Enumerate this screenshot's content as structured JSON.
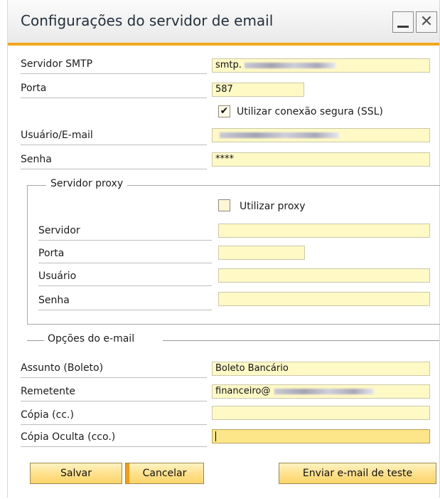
{
  "window": {
    "title": "Configurações do servidor de email",
    "minimize_glyph": "_",
    "close_glyph": "✕"
  },
  "smtp": {
    "server_label": "Servidor SMTP",
    "server_value": "smtp.",
    "port_label": "Porta",
    "port_value": "587",
    "ssl_label": "Utilizar conexão segura (SSL)",
    "ssl_checked": true,
    "ssl_mark": "✔",
    "user_label": "Usuário/E-mail",
    "user_value": "",
    "password_label": "Senha",
    "password_value": "****"
  },
  "proxy": {
    "group_title": "Servidor proxy",
    "use_label": "Utilizar proxy",
    "use_checked": false,
    "server_label": "Servidor",
    "server_value": "",
    "port_label": "Porta",
    "port_value": "",
    "user_label": "Usuário",
    "user_value": "",
    "password_label": "Senha",
    "password_value": ""
  },
  "email_options": {
    "group_title": "Opções do e-mail",
    "subject_label": "Assunto (Boleto)",
    "subject_value": "Boleto Bancário",
    "sender_label": "Remetente",
    "sender_value": "financeiro@",
    "cc_label": "Cópia (cc.)",
    "cc_value": "",
    "bcc_label": "Cópia Oculta (cco.)",
    "bcc_value": ""
  },
  "buttons": {
    "save_label": "Salvar",
    "cancel_label": "Cancelar",
    "test_label": "Enviar e-mail de teste"
  },
  "colors": {
    "field_bg": "#fff9c6",
    "accent_orange": "#f2a81d",
    "button_bg": "#ffe08a"
  }
}
